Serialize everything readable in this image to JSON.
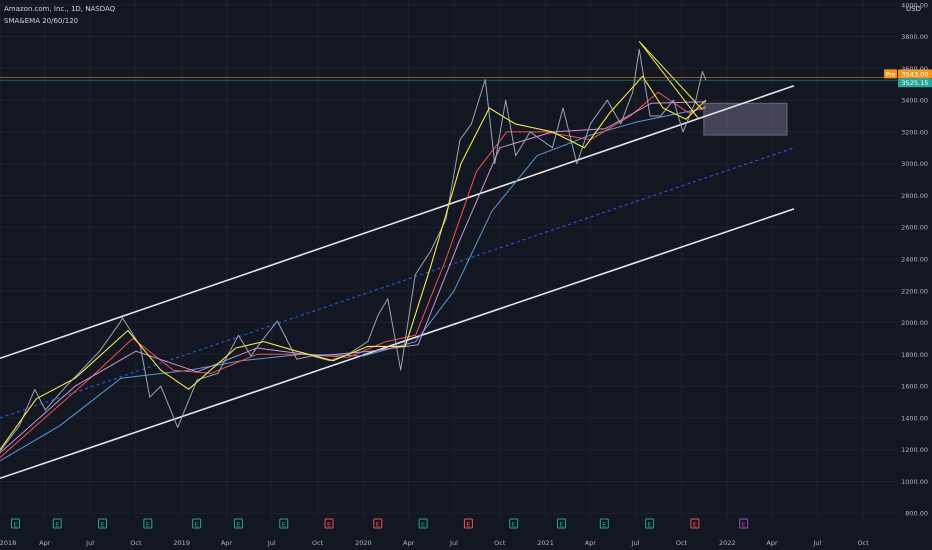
{
  "header": {
    "title": "Amazon.com, Inc., 1D, NASDAQ",
    "indicator": "SMA&EMA 20/60/120",
    "currency": "USD"
  },
  "colors": {
    "background": "#131722",
    "grid": "#1e222d",
    "text": "#b2b5be",
    "price": "#9aa5b1",
    "channel": "#e6e6ec",
    "midline": "#2962ff",
    "sma20": "#f5e94b",
    "sma60": "#ef5350",
    "sma120": "#5b9bd5",
    "ema": "#ce93d8",
    "zone": "#6e6780",
    "pre_tag": "#f7931a",
    "last_tag": "#26a69a"
  },
  "chart_data": {
    "type": "line",
    "ylim": [
      770,
      4030
    ],
    "y_ticks": [
      800,
      1000,
      1200,
      1400,
      1600,
      1800,
      2000,
      2200,
      2400,
      2600,
      2800,
      3000,
      3200,
      3400,
      3600,
      3800,
      4000
    ],
    "y_tick_labels": [
      "800.00",
      "1000.00",
      "1200.00",
      "1400.00",
      "1600.00",
      "1800.00",
      "2000.00",
      "2200.00",
      "2400.00",
      "2600.00",
      "2800.00",
      "3000.00",
      "3200.00",
      "3400.00",
      "3600.00",
      "3800.00",
      "4000.00"
    ],
    "xlim": [
      "2018-01-01",
      "2022-12-10"
    ],
    "x_ticks": [
      {
        "date": "2018-01-01",
        "label": "2018"
      },
      {
        "date": "2018-04-01",
        "label": "Apr"
      },
      {
        "date": "2018-07-01",
        "label": "Jul"
      },
      {
        "date": "2018-10-01",
        "label": "Oct"
      },
      {
        "date": "2019-01-01",
        "label": "2019"
      },
      {
        "date": "2019-04-01",
        "label": "Apr"
      },
      {
        "date": "2019-07-01",
        "label": "Jul"
      },
      {
        "date": "2019-10-01",
        "label": "Oct"
      },
      {
        "date": "2020-01-01",
        "label": "2020"
      },
      {
        "date": "2020-04-01",
        "label": "Apr"
      },
      {
        "date": "2020-07-01",
        "label": "Jul"
      },
      {
        "date": "2020-10-01",
        "label": "Oct"
      },
      {
        "date": "2021-01-01",
        "label": "2021"
      },
      {
        "date": "2021-04-01",
        "label": "Apr"
      },
      {
        "date": "2021-07-01",
        "label": "Jul"
      },
      {
        "date": "2021-10-01",
        "label": "Oct"
      },
      {
        "date": "2022-01-01",
        "label": "2022"
      },
      {
        "date": "2022-04-01",
        "label": "Apr"
      },
      {
        "date": "2022-07-01",
        "label": "Jul"
      },
      {
        "date": "2022-10-01",
        "label": "Oct"
      }
    ],
    "price": {
      "x": [
        "2018-01-01",
        "2018-02-09",
        "2018-03-12",
        "2018-04-02",
        "2018-05-14",
        "2018-06-20",
        "2018-07-20",
        "2018-08-30",
        "2018-09-04",
        "2018-10-10",
        "2018-10-29",
        "2018-11-20",
        "2018-12-24",
        "2019-02-01",
        "2019-03-15",
        "2019-04-25",
        "2019-05-20",
        "2019-06-10",
        "2019-07-12",
        "2019-08-20",
        "2019-09-20",
        "2019-10-25",
        "2019-12-01",
        "2020-01-10",
        "2020-01-31",
        "2020-02-19",
        "2020-03-16",
        "2020-04-14",
        "2020-05-15",
        "2020-06-15",
        "2020-07-13",
        "2020-08-05",
        "2020-09-02",
        "2020-09-21",
        "2020-10-13",
        "2020-11-02",
        "2020-12-01",
        "2021-01-15",
        "2021-02-05",
        "2021-03-05",
        "2021-04-01",
        "2021-05-05",
        "2021-06-01",
        "2021-06-25",
        "2021-07-08",
        "2021-07-30",
        "2021-08-20",
        "2021-09-15",
        "2021-10-04",
        "2021-10-29",
        "2021-11-12",
        "2021-11-19"
      ],
      "y": [
        1190,
        1350,
        1580,
        1450,
        1600,
        1720,
        1820,
        2000,
        2030,
        1850,
        1530,
        1600,
        1340,
        1640,
        1680,
        1920,
        1790,
        1880,
        2010,
        1770,
        1790,
        1760,
        1800,
        1880,
        2050,
        2150,
        1700,
        2300,
        2450,
        2650,
        3150,
        3250,
        3530,
        3000,
        3400,
        3050,
        3200,
        3100,
        3350,
        3000,
        3250,
        3400,
        3250,
        3450,
        3720,
        3300,
        3300,
        3400,
        3200,
        3390,
        3580,
        3525
      ]
    },
    "sma20": {
      "x": [
        "2018-01-01",
        "2018-03-15",
        "2018-06-01",
        "2018-09-15",
        "2018-11-20",
        "2019-01-15",
        "2019-04-20",
        "2019-06-15",
        "2019-08-20",
        "2019-11-01",
        "2020-01-10",
        "2020-03-25",
        "2020-05-15",
        "2020-07-15",
        "2020-09-10",
        "2020-11-01",
        "2021-01-15",
        "2021-03-20",
        "2021-05-10",
        "2021-07-15",
        "2021-08-25",
        "2021-10-10",
        "2021-11-19"
      ],
      "y": [
        1200,
        1520,
        1650,
        1950,
        1700,
        1580,
        1840,
        1880,
        1820,
        1760,
        1850,
        1850,
        2350,
        3000,
        3350,
        3250,
        3200,
        3100,
        3320,
        3550,
        3350,
        3280,
        3400
      ]
    },
    "sma60": {
      "x": [
        "2018-01-01",
        "2018-04-01",
        "2018-07-01",
        "2018-09-25",
        "2018-12-15",
        "2019-03-01",
        "2019-06-01",
        "2019-09-01",
        "2019-12-01",
        "2020-02-15",
        "2020-04-15",
        "2020-06-15",
        "2020-08-15",
        "2020-10-15",
        "2021-01-01",
        "2021-04-01",
        "2021-06-20",
        "2021-08-15",
        "2021-10-15",
        "2021-11-19"
      ],
      "y": [
        1150,
        1400,
        1650,
        1900,
        1700,
        1680,
        1800,
        1800,
        1780,
        1880,
        1920,
        2400,
        2950,
        3200,
        3200,
        3150,
        3300,
        3450,
        3320,
        3360
      ]
    },
    "sma120": {
      "x": [
        "2018-01-01",
        "2018-05-01",
        "2018-09-01",
        "2019-01-15",
        "2019-05-01",
        "2019-09-01",
        "2020-01-01",
        "2020-04-15",
        "2020-07-01",
        "2020-09-15",
        "2020-12-15",
        "2021-04-01",
        "2021-07-01",
        "2021-10-01",
        "2021-11-19"
      ],
      "y": [
        1130,
        1350,
        1650,
        1700,
        1760,
        1800,
        1790,
        1880,
        2200,
        2700,
        3050,
        3180,
        3260,
        3320,
        3350
      ]
    },
    "ema": {
      "x": [
        "2018-01-01",
        "2018-06-01",
        "2018-10-01",
        "2019-02-01",
        "2019-06-01",
        "2019-10-01",
        "2020-01-15",
        "2020-04-20",
        "2020-07-10",
        "2020-10-01",
        "2021-01-15",
        "2021-05-01",
        "2021-08-01",
        "2021-11-19"
      ],
      "y": [
        1180,
        1600,
        1820,
        1690,
        1840,
        1790,
        1820,
        1860,
        2500,
        3100,
        3200,
        3220,
        3380,
        3390
      ]
    },
    "channel_upper": {
      "x": [
        "2018-01-01",
        "2022-05-15"
      ],
      "y": [
        1775,
        3490
      ]
    },
    "channel_lower": {
      "x": [
        "2018-01-01",
        "2022-05-15"
      ],
      "y": [
        1020,
        2715
      ]
    },
    "channel_mid": {
      "x": [
        "2018-01-01",
        "2022-05-15"
      ],
      "y": [
        1400,
        3100
      ]
    },
    "triangle": [
      {
        "x": [
          "2021-07-08",
          "2021-11-12"
        ],
        "y": [
          3770,
          3340
        ]
      },
      {
        "x": [
          "2021-07-08",
          "2021-11-05"
        ],
        "y": [
          3770,
          3280
        ]
      }
    ],
    "zone": {
      "x": [
        "2021-11-15",
        "2022-05-01"
      ],
      "y": [
        3180,
        3380
      ]
    },
    "price_lines": [
      {
        "label": "Pre",
        "value": 3543.0,
        "value_label": "3543.00",
        "color": "#f7931a"
      },
      {
        "label": "",
        "value": 3525.15,
        "value_label": "3525.15",
        "color": "#26a69a"
      }
    ],
    "earnings": [
      {
        "date": "2018-02-01",
        "label": "E",
        "kind": "past"
      },
      {
        "date": "2018-04-26",
        "label": "E",
        "kind": "past"
      },
      {
        "date": "2018-07-26",
        "label": "E",
        "kind": "past"
      },
      {
        "date": "2018-10-25",
        "label": "E",
        "kind": "past"
      },
      {
        "date": "2019-01-31",
        "label": "E",
        "kind": "past"
      },
      {
        "date": "2019-04-25",
        "label": "E",
        "kind": "past"
      },
      {
        "date": "2019-07-25",
        "label": "E",
        "kind": "past"
      },
      {
        "date": "2019-10-24",
        "label": "E",
        "kind": "miss"
      },
      {
        "date": "2020-01-30",
        "label": "E",
        "kind": "miss"
      },
      {
        "date": "2020-04-30",
        "label": "E",
        "kind": "past"
      },
      {
        "date": "2020-07-30",
        "label": "E",
        "kind": "miss"
      },
      {
        "date": "2020-10-29",
        "label": "E",
        "kind": "past"
      },
      {
        "date": "2021-02-02",
        "label": "E",
        "kind": "past"
      },
      {
        "date": "2021-04-29",
        "label": "E",
        "kind": "past"
      },
      {
        "date": "2021-07-29",
        "label": "E",
        "kind": "past"
      },
      {
        "date": "2021-10-28",
        "label": "E",
        "kind": "miss"
      },
      {
        "date": "2022-02-03",
        "label": "E",
        "kind": "future"
      }
    ]
  }
}
